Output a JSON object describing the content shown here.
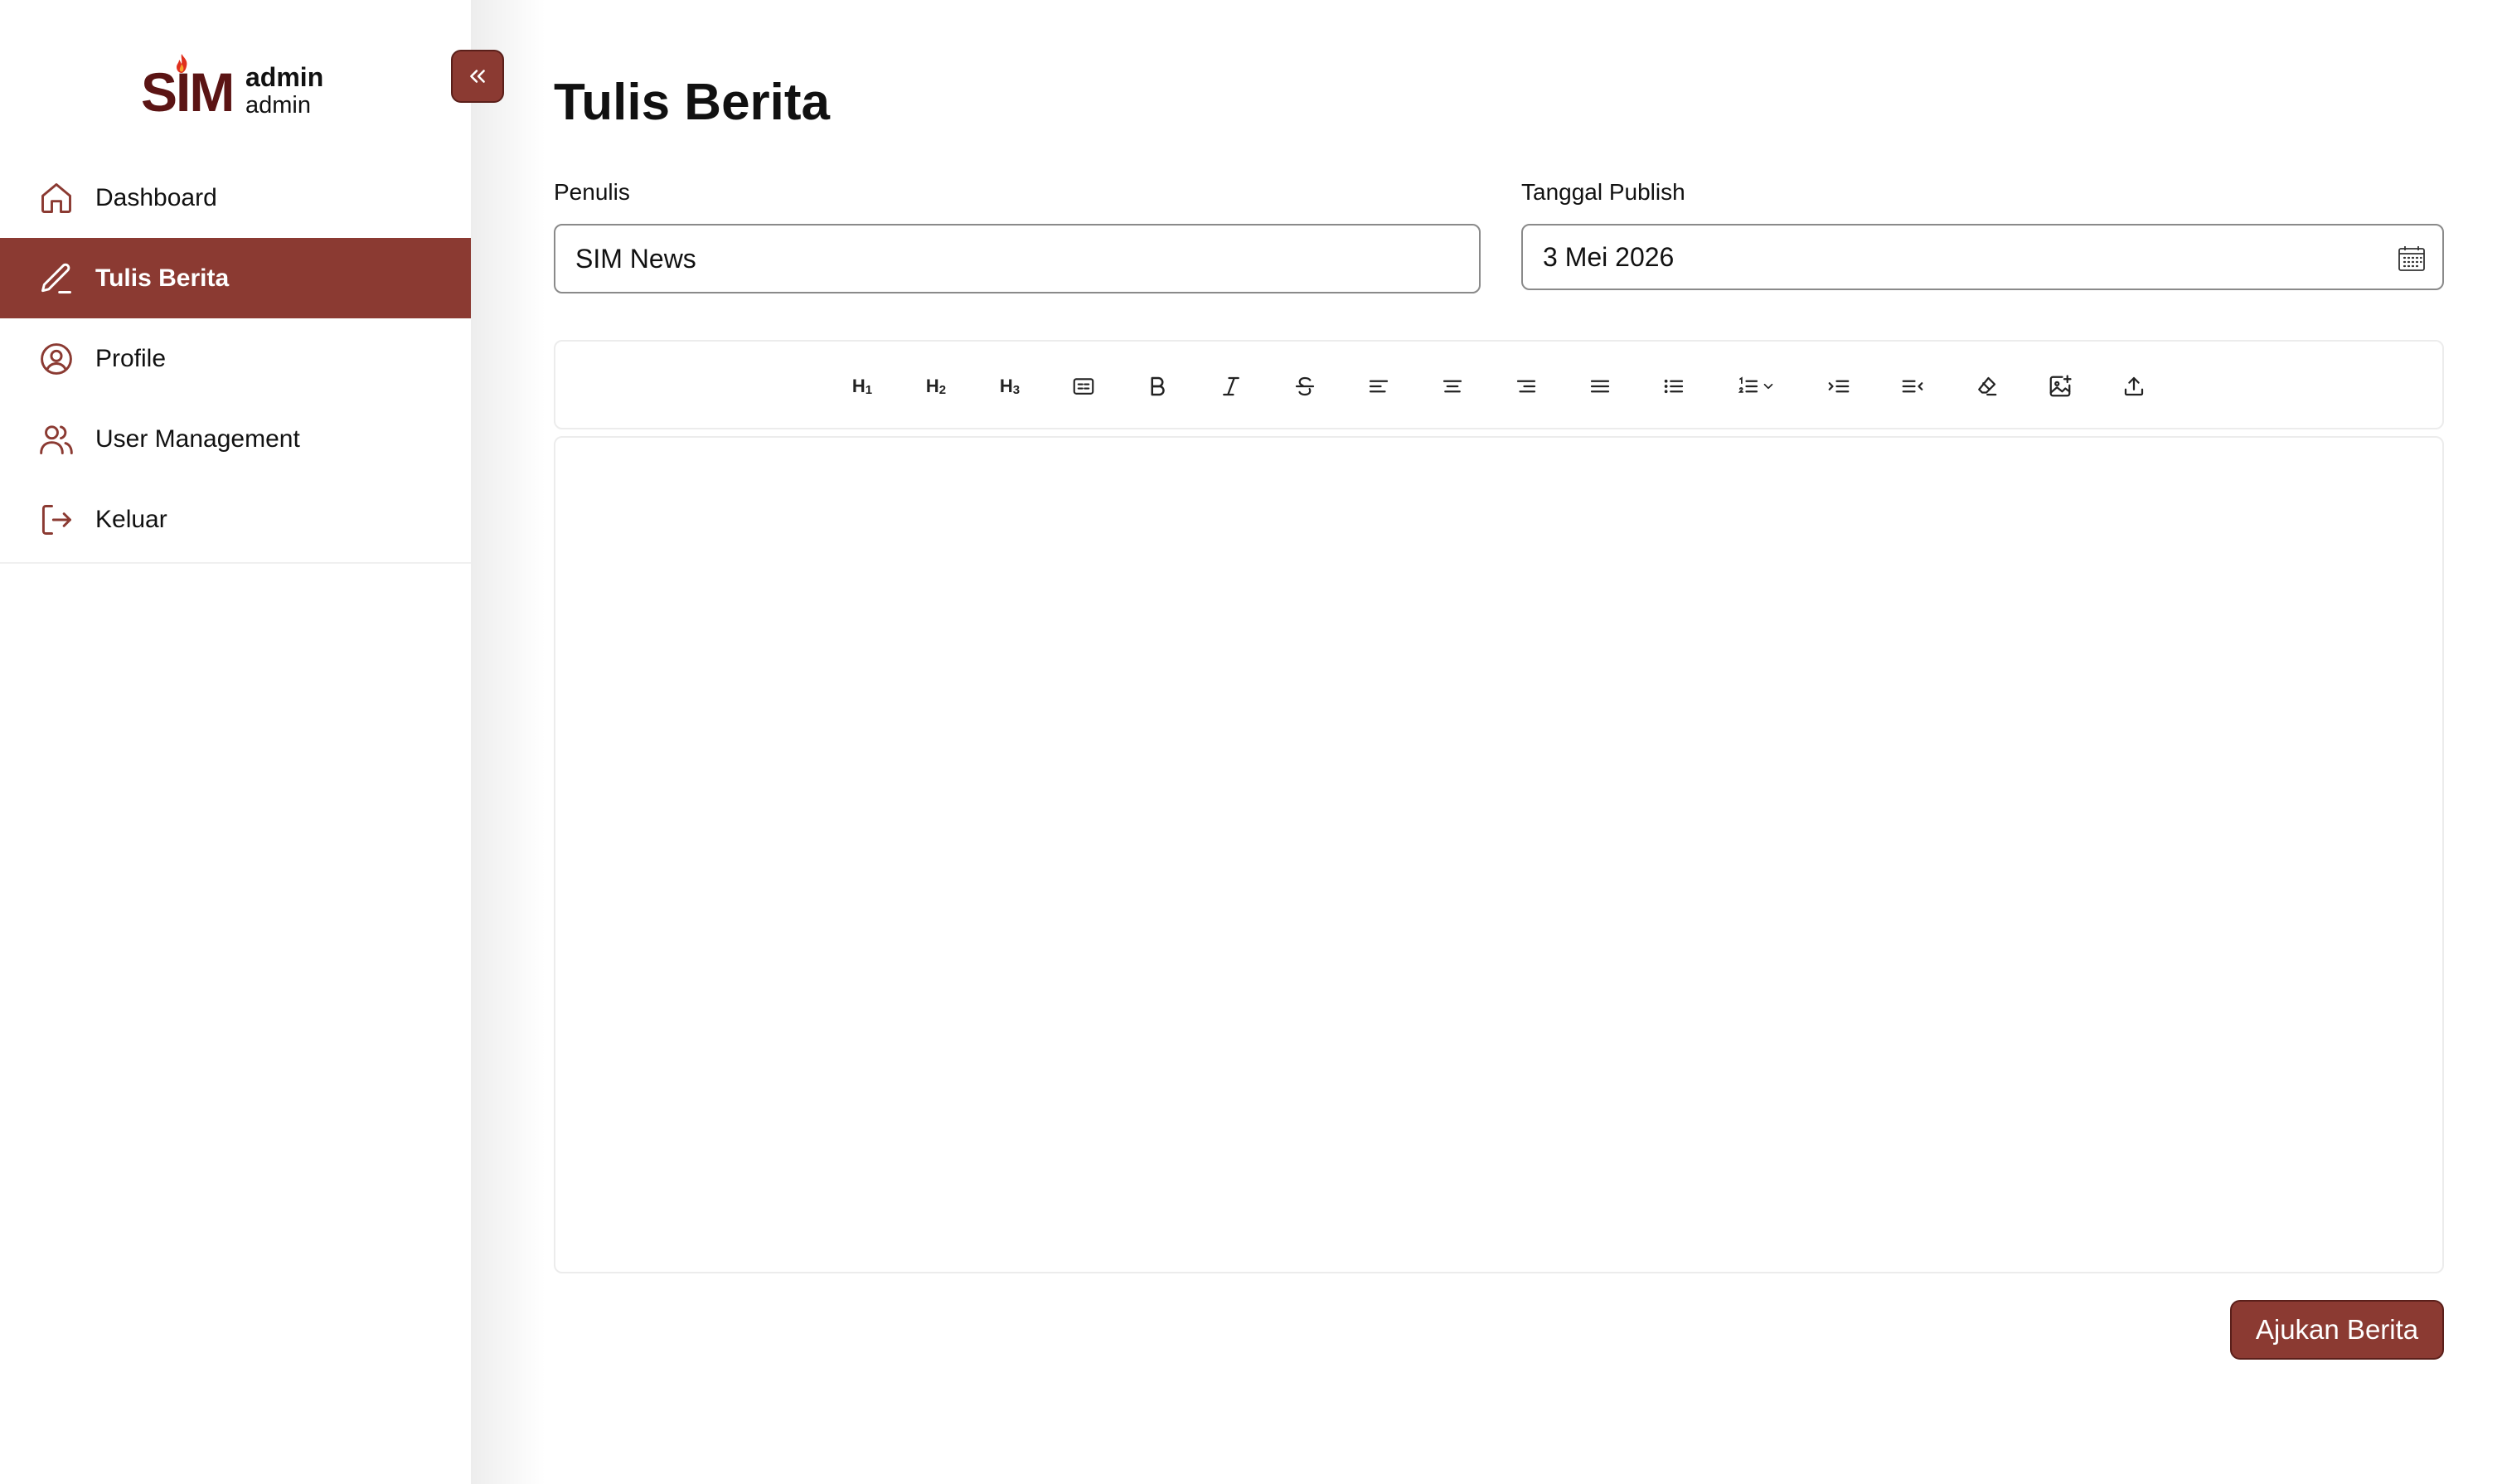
{
  "brand": {
    "logo_text": "SIM",
    "accent_color": "#8b3a32",
    "logo_color": "#5b1414"
  },
  "user": {
    "name": "admin",
    "role": "admin"
  },
  "sidebar": {
    "collapse_icon": "chevrons-left-icon",
    "items": [
      {
        "label": "Dashboard",
        "icon": "home-icon",
        "active": false
      },
      {
        "label": "Tulis Berita",
        "icon": "pencil-icon",
        "active": true
      },
      {
        "label": "Profile",
        "icon": "user-circle-icon",
        "active": false
      },
      {
        "label": "User Management",
        "icon": "users-icon",
        "active": false
      },
      {
        "label": "Keluar",
        "icon": "logout-icon",
        "active": false
      }
    ]
  },
  "page": {
    "title": "Tulis Berita"
  },
  "form": {
    "penulis_label": "Penulis",
    "penulis_value": "SIM News",
    "tanggal_label": "Tanggal Publish",
    "tanggal_value": "3 Mei 2026"
  },
  "toolbar": {
    "buttons": [
      {
        "name": "heading-1",
        "text": "H",
        "sub": "1"
      },
      {
        "name": "heading-2",
        "text": "H",
        "sub": "2"
      },
      {
        "name": "heading-3",
        "text": "H",
        "sub": "3"
      },
      {
        "name": "paragraph-icon"
      },
      {
        "name": "bold-icon"
      },
      {
        "name": "italic-icon"
      },
      {
        "name": "strikethrough-icon"
      },
      {
        "name": "align-left-icon"
      },
      {
        "name": "align-center-icon"
      },
      {
        "name": "align-right-icon"
      },
      {
        "name": "align-justify-icon"
      },
      {
        "name": "bullet-list-icon"
      },
      {
        "name": "ordered-list-icon"
      },
      {
        "name": "indent-icon"
      },
      {
        "name": "outdent-icon"
      },
      {
        "name": "clear-format-icon"
      },
      {
        "name": "insert-image-icon"
      },
      {
        "name": "upload-icon"
      }
    ]
  },
  "actions": {
    "submit_label": "Ajukan Berita"
  }
}
